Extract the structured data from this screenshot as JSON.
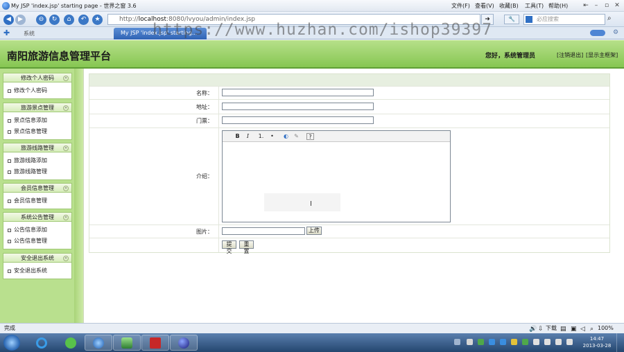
{
  "browser": {
    "title": "My JSP 'index.jsp' starting page - 世界之窗 3.6",
    "menu": [
      "文件(F)",
      "查看(V)",
      "收藏(B)",
      "工具(T)",
      "帮助(H)"
    ],
    "address_prefix": "http://",
    "address_host": "localhost",
    "address_rest": ":8080/lvyou/admin/index.jsp",
    "search_placeholder": "必应搜索",
    "tabs": [
      "系统",
      "My JSP 'index.jsp' starting..."
    ],
    "watermark": "https://www.huzhan.com/ishop39397",
    "status_text": "完成",
    "download_label": "下载",
    "zoom": "100%"
  },
  "app": {
    "title": "南阳旅游信息管理平台",
    "greeting": "您好，系统管理员",
    "logout_link": "[注销退出]",
    "home_link": "[显示主框架]"
  },
  "sidebar": {
    "sections": [
      {
        "title": "修改个人密码",
        "items": [
          "修改个人密码"
        ]
      },
      {
        "title": "旅游景点管理",
        "items": [
          "景点信息添加",
          "景点信息管理"
        ]
      },
      {
        "title": "旅游线路管理",
        "items": [
          "旅游线路添加",
          "旅游线路管理"
        ]
      },
      {
        "title": "会员信息管理",
        "items": [
          "会员信息管理"
        ]
      },
      {
        "title": "系统公告管理",
        "items": [
          "公告信息添加",
          "公告信息管理"
        ]
      },
      {
        "title": "安全退出系统",
        "items": [
          "安全退出系统"
        ]
      }
    ]
  },
  "form": {
    "name_label": "名称：",
    "address_label": "地址：",
    "ticket_label": "门票：",
    "intro_label": "介绍：",
    "image_label": "图片：",
    "upload_button": "上传",
    "submit_button": "提交",
    "reset_button": "重置",
    "toolbar": [
      "B",
      "I",
      "1.",
      "•",
      "◐",
      "✎",
      "?"
    ]
  },
  "taskbar": {
    "time": "14:47",
    "date": "2013-03-28"
  }
}
